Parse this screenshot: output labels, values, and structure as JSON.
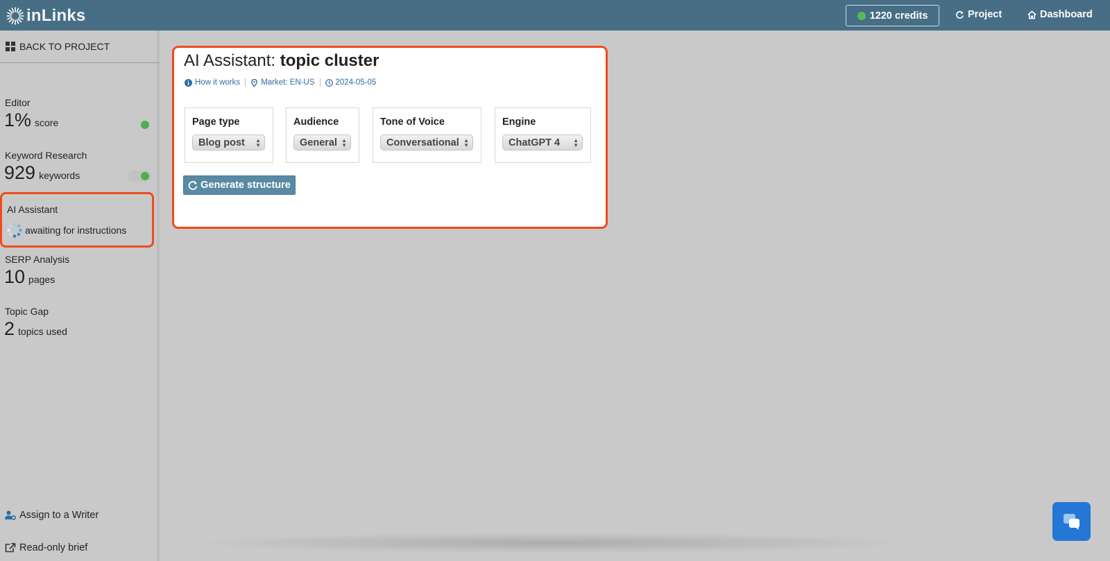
{
  "header": {
    "logo_text": "inLinks",
    "credits_label": "1220 credits",
    "credits_status_color": "#5cb85c",
    "project_label": "Project",
    "dashboard_label": "Dashboard"
  },
  "sidebar": {
    "back_label": "BACK TO PROJECT",
    "editor": {
      "label": "Editor",
      "value": "1%",
      "unit": "score"
    },
    "keyword_research": {
      "label": "Keyword Research",
      "value": "929",
      "unit": "keywords"
    },
    "ai_assistant": {
      "label": "AI Assistant",
      "status": "awaiting for instructions"
    },
    "serp_analysis": {
      "label": "SERP Analysis",
      "value": "10",
      "unit": "pages"
    },
    "topic_gap": {
      "label": "Topic Gap",
      "value": "2",
      "unit": "topics used"
    },
    "assign_label": "Assign to a Writer",
    "readonly_label": "Read-only brief"
  },
  "panel": {
    "title_prefix": "AI Assistant: ",
    "title_topic": "topic cluster",
    "how_it_works": "How it works",
    "market": "Market: EN-US",
    "date": "2024-05-05",
    "fields": [
      {
        "label": "Page type",
        "value": "Blog post"
      },
      {
        "label": "Audience",
        "value": "General"
      },
      {
        "label": "Tone of Voice",
        "value": "Conversational"
      },
      {
        "label": "Engine",
        "value": "ChatGPT 4"
      }
    ],
    "generate_label": "Generate structure"
  },
  "colors": {
    "topbar": "#476e85",
    "highlight": "#f04a1e",
    "link": "#2e6da4",
    "button": "#5a8aa3",
    "chat": "#2477d4"
  }
}
